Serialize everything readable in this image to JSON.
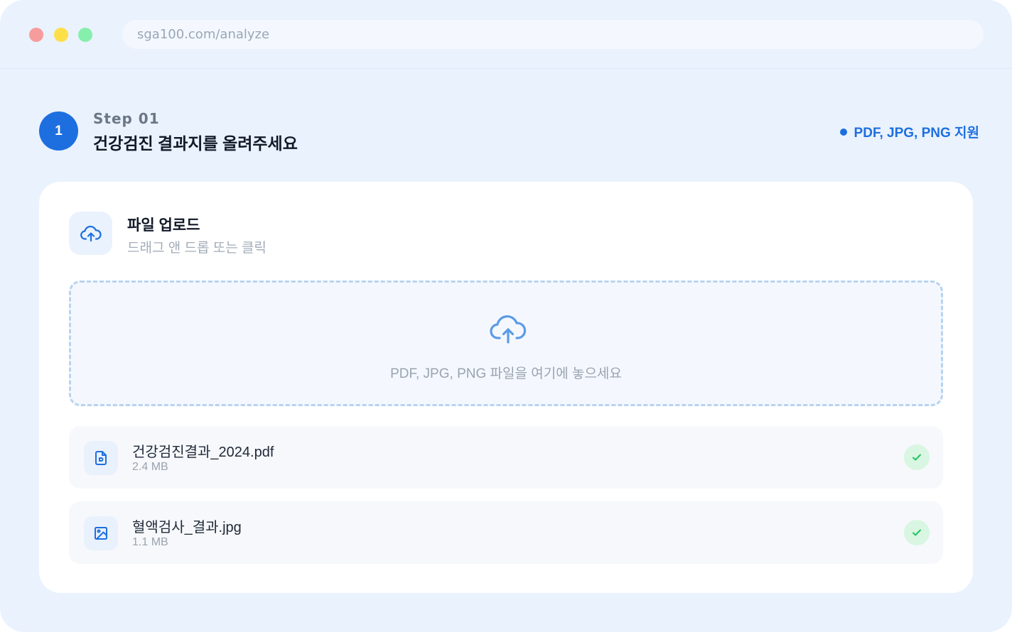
{
  "browser": {
    "url": "sga100.com/analyze"
  },
  "step": {
    "number": "1",
    "kicker": "Step 01",
    "title": "건강검진 결과지를 올려주세요",
    "support_label": "PDF, JPG, PNG 지원"
  },
  "upload": {
    "title": "파일 업로드",
    "subtitle": "드래그 앤 드롭 또는 클릭",
    "dropzone_text": "PDF, JPG, PNG 파일을 여기에 놓으세요"
  },
  "files": [
    {
      "name": "건강검진결과_2024.pdf",
      "size": "2.4 MB",
      "icon": "pdf-file-icon",
      "status": "uploaded"
    },
    {
      "name": "혈액검사_결과.jpg",
      "size": "1.1 MB",
      "icon": "image-file-icon",
      "status": "uploaded"
    }
  ],
  "colors": {
    "accent": "#1d6fe0",
    "background": "#e9f2fd",
    "success": "#22c55e"
  }
}
